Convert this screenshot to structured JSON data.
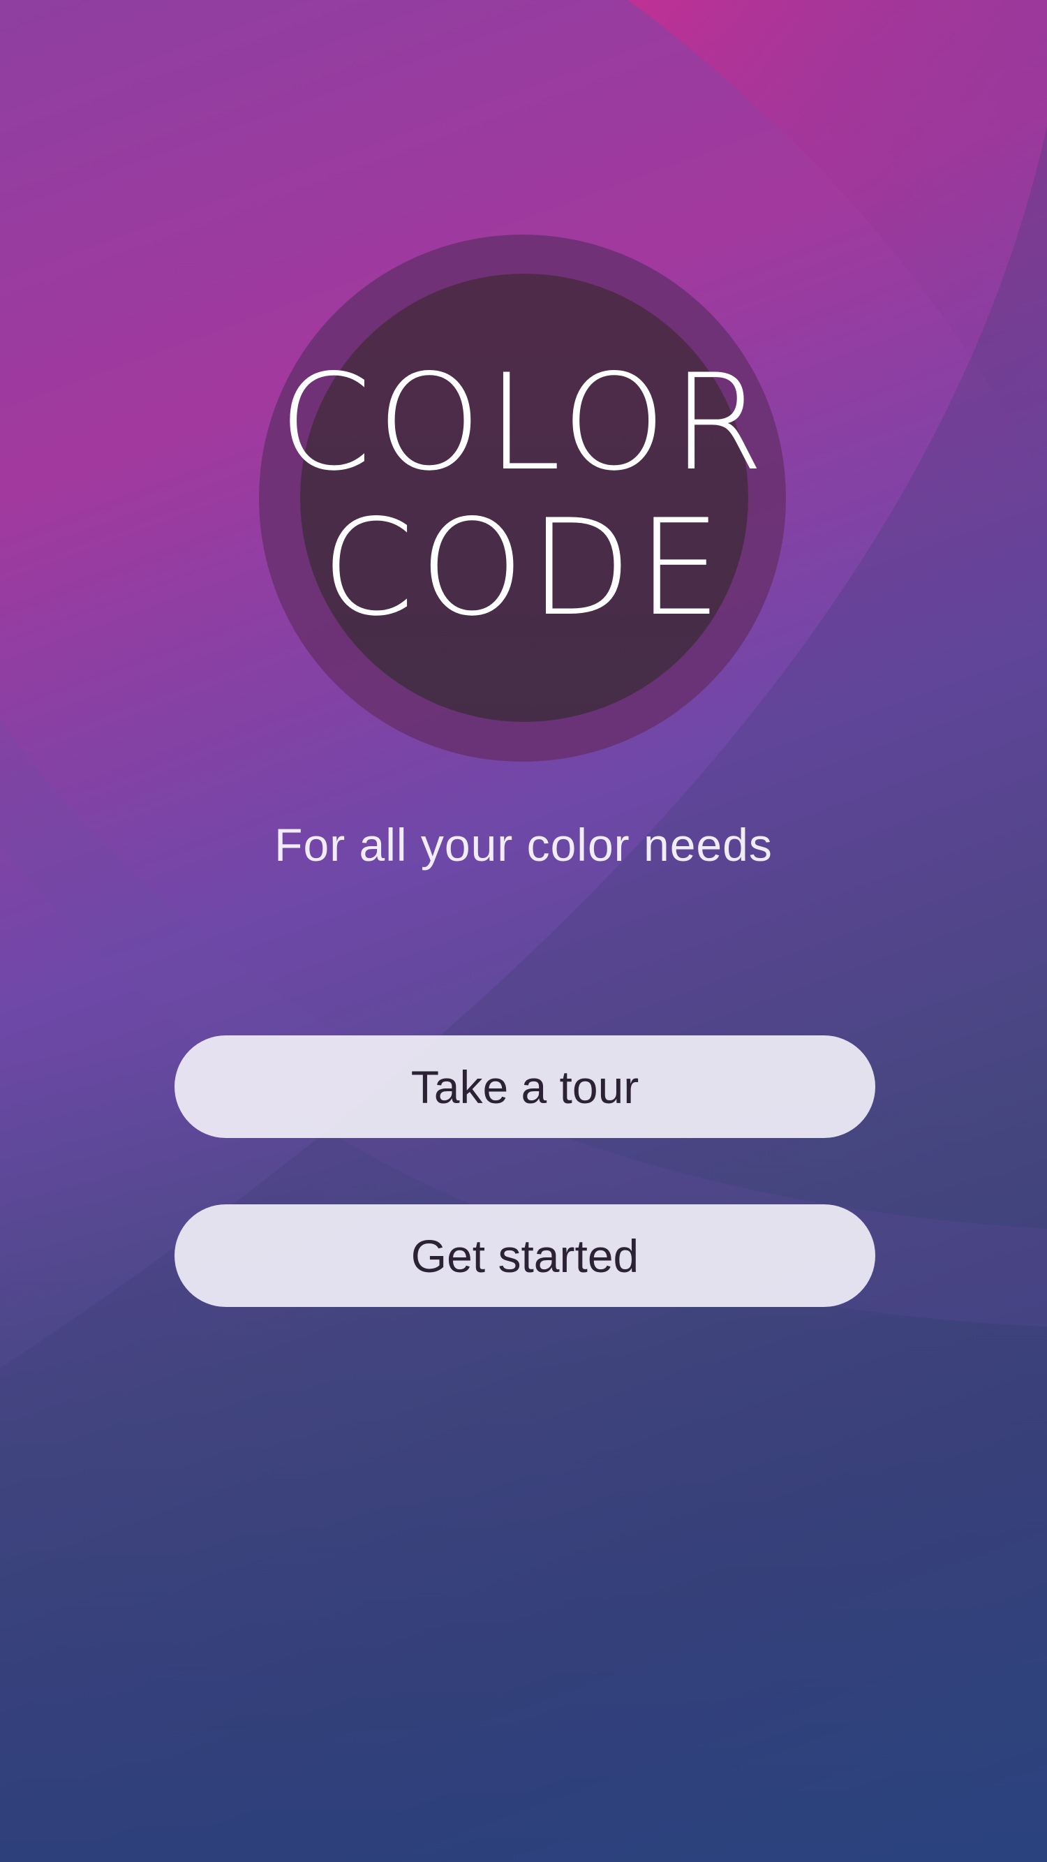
{
  "app": {
    "name_line_1": "Color",
    "name_line_2": "Code",
    "tagline": "For all your color needs"
  },
  "actions": {
    "tour_label": "Take a tour",
    "start_label": "Get started"
  },
  "colors": {
    "background_top": "#a2399f",
    "background_bottom": "#2b4b86",
    "logo_ring": "#69306e",
    "logo_disc": "#4b2c48",
    "button_fill": "#ECEAF4",
    "button_text": "#2b2235"
  }
}
